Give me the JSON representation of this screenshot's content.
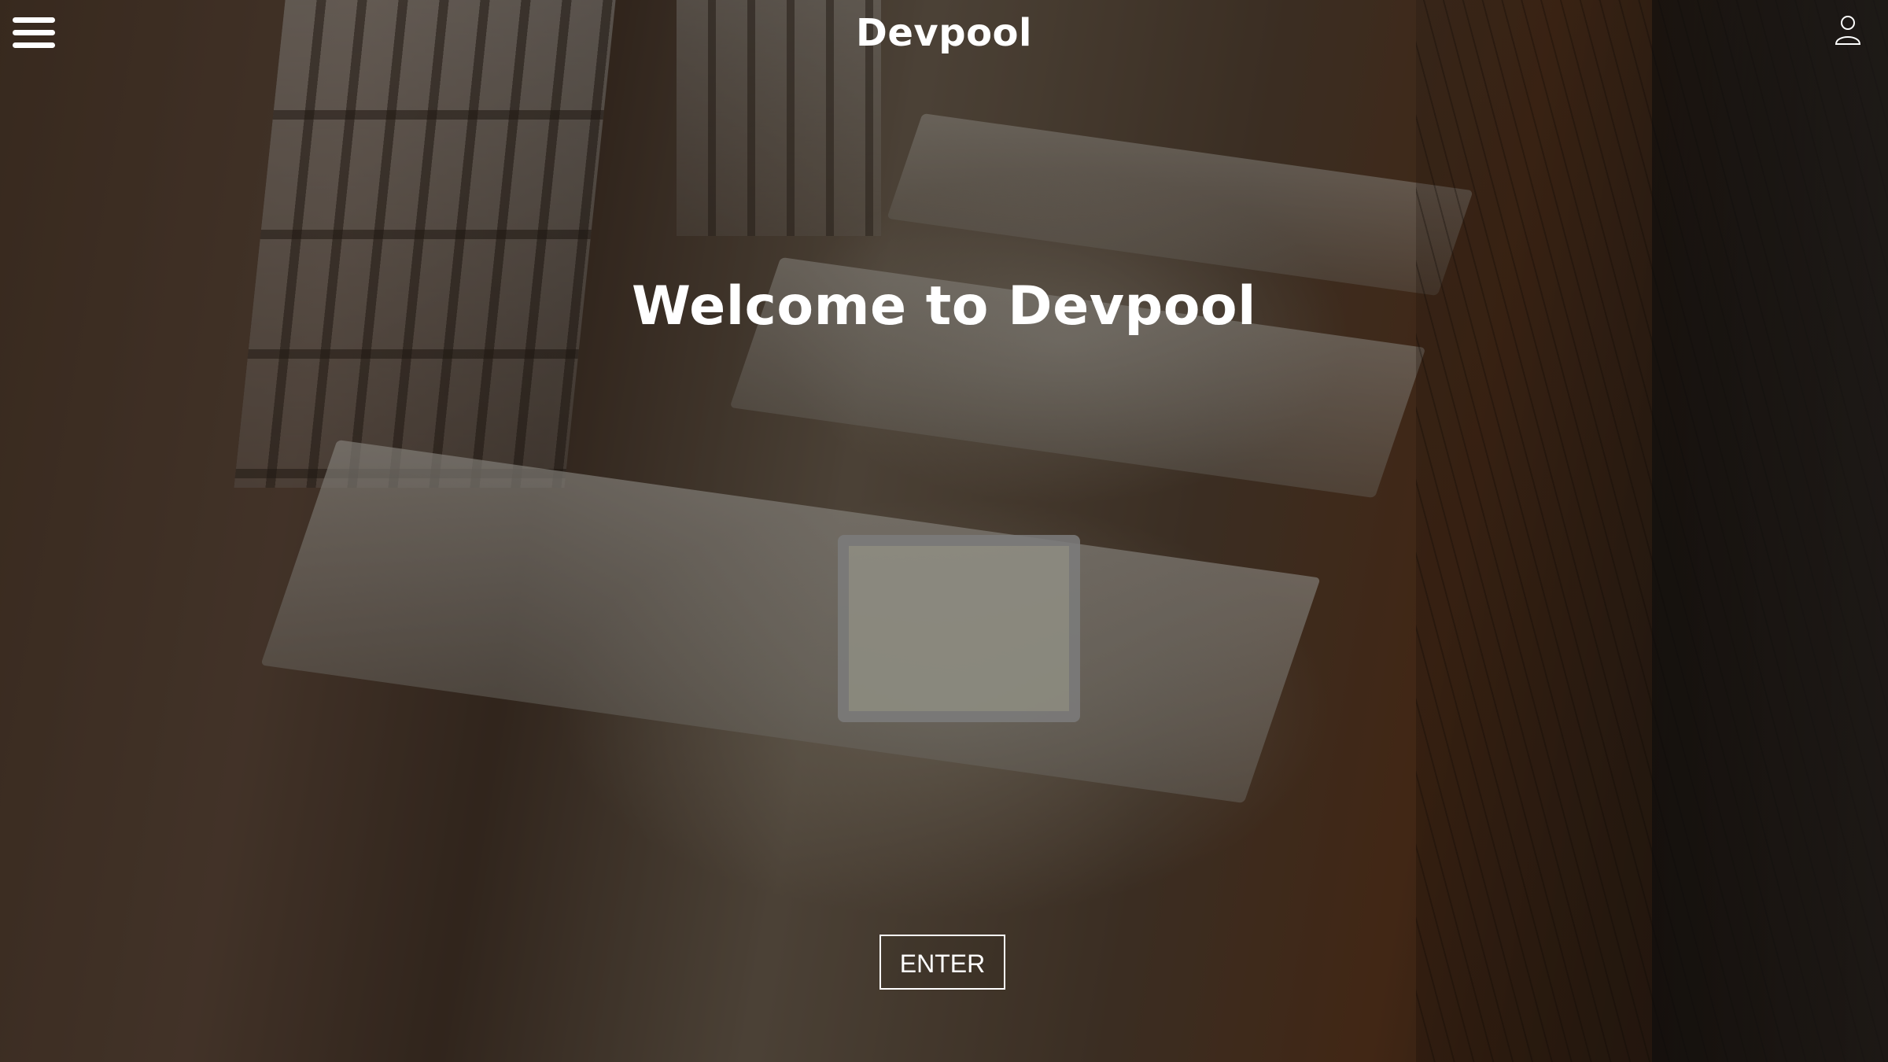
{
  "header": {
    "brand": "Devpool",
    "menu_icon": "hamburger-menu-icon",
    "user_icon": "user-icon"
  },
  "hero": {
    "headline": "Welcome to Devpool",
    "enter_label": "ENTER",
    "background": "office-photo"
  },
  "colors": {
    "text": "#ffffff",
    "overlay": "#000000"
  }
}
